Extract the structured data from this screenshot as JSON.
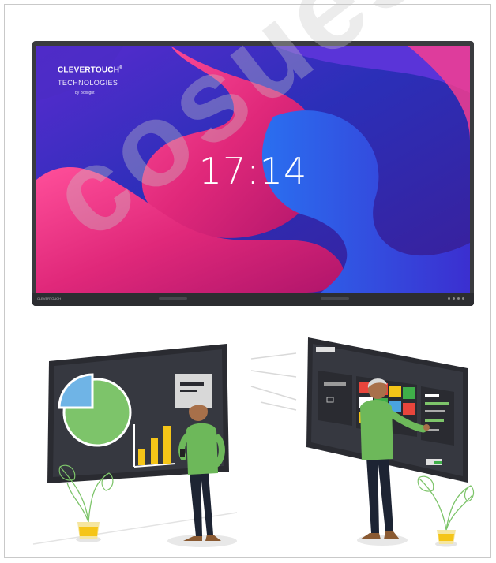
{
  "display": {
    "brand_name": "CLEVERTOUCH",
    "brand_mark": "®",
    "brand_sub": "TECHNOLOGIES",
    "brand_by": "by Boxlight",
    "clock_time": "17:14",
    "footer_brand": "CLEVERTOUCH"
  },
  "watermark": "cosues",
  "colors": {
    "bezel": "#3a3b3f",
    "pie_blue": "#6fb4e6",
    "pie_green": "#7dc46a",
    "bar_yellow": "#f5c518",
    "shirt_green": "#6db85a",
    "tile_red": "#e8453c",
    "tile_yellow": "#f5c518",
    "tile_green": "#3fae49",
    "tile_blue": "#4aa3df"
  },
  "icons": [
    "plant-icon",
    "pie-chart-icon",
    "bar-chart-icon",
    "window-icon"
  ]
}
